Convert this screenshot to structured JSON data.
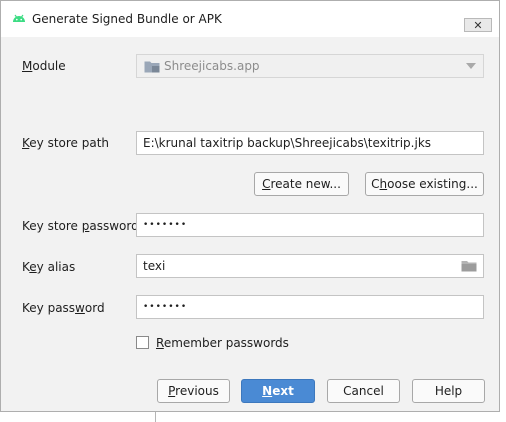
{
  "window": {
    "title": "Generate Signed Bundle or APK",
    "close_glyph": "✕"
  },
  "module": {
    "label": "Module",
    "value": "Shreejicabs.app",
    "icon": "folder-module-icon"
  },
  "key_store_path": {
    "label": "Key store path",
    "value": "E:\\krunal taxitrip backup\\Shreejicabs\\texitrip.jks"
  },
  "buttons": {
    "create_new": "Create new...",
    "choose_existing": "Choose existing...",
    "previous": "Previous",
    "next": "Next",
    "cancel": "Cancel",
    "help": "Help"
  },
  "key_store_password": {
    "label": "Key store password",
    "masked_value": "•••••••"
  },
  "key_alias": {
    "label": "Key alias",
    "value": "texi",
    "icon": "folder-icon"
  },
  "key_password": {
    "label": "Key password",
    "masked_value": "•••••••"
  },
  "remember_passwords": {
    "label": "Remember passwords",
    "checked": false
  },
  "colors": {
    "primary_button": "#4a8ad4",
    "android_green": "#3ddc84"
  }
}
